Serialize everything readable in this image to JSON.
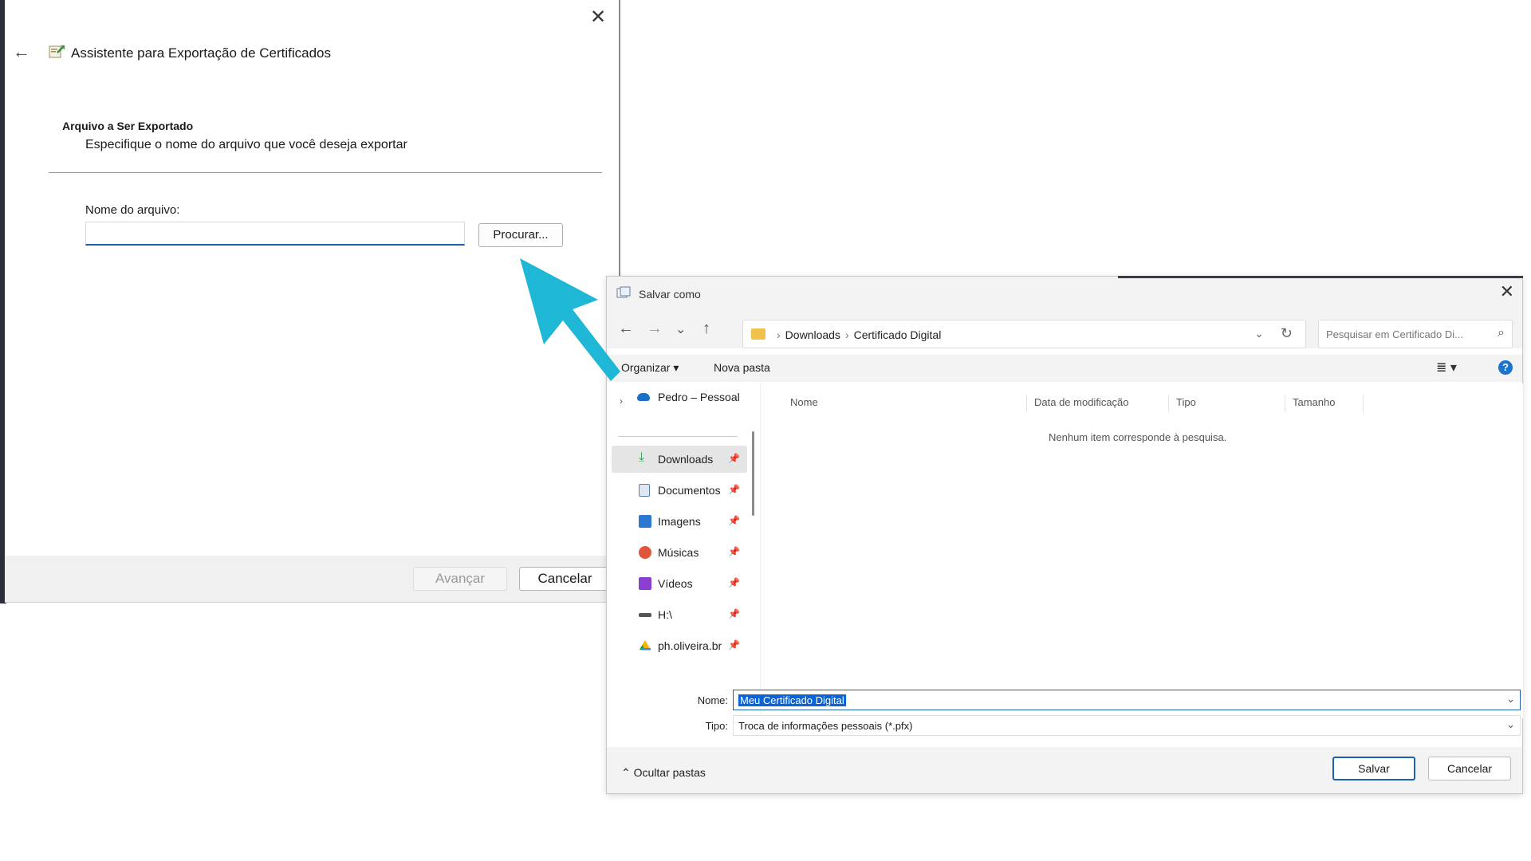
{
  "wizard": {
    "title": "Assistente para Exportação de Certificados",
    "heading": "Arquivo a Ser Exportado",
    "subheading": "Especifique o nome do arquivo que você deseja exportar",
    "file_label": "Nome do arquivo:",
    "file_value": "",
    "browse_label": "Procurar...",
    "next_label": "Avançar",
    "cancel_label": "Cancelar",
    "close_glyph": "✕",
    "back_glyph": "←"
  },
  "save_dialog": {
    "title": "Salvar como",
    "close_glyph": "✕",
    "nav": {
      "back": "←",
      "forward": "→",
      "recent": "⌄",
      "up": "↑"
    },
    "breadcrumb": [
      "Downloads",
      "Certificado Digital"
    ],
    "search_placeholder": "Pesquisar em Certificado Di...",
    "toolbar": {
      "organize": "Organizar ▾",
      "new_folder": "Nova pasta",
      "view": "≣ ▾",
      "help": "?"
    },
    "nav_pane": {
      "cloud": "Pedro – Pessoal",
      "items": [
        {
          "label": "Downloads",
          "icon": "download-icon",
          "color": "#2e9e4f"
        },
        {
          "label": "Documentos",
          "icon": "document-icon",
          "color": "#5a7fb5"
        },
        {
          "label": "Imagens",
          "icon": "image-icon",
          "color": "#2a78d0"
        },
        {
          "label": "Músicas",
          "icon": "music-icon",
          "color": "#e0563b"
        },
        {
          "label": "Vídeos",
          "icon": "video-icon",
          "color": "#8a3fd0"
        },
        {
          "label": "H:\\",
          "icon": "drive-icon",
          "color": "#555555"
        },
        {
          "label": "ph.oliveira.br",
          "icon": "google-drive-icon",
          "color": "#f4b400"
        }
      ]
    },
    "columns": [
      "Nome",
      "Data de modificação",
      "Tipo",
      "Tamanho"
    ],
    "empty_message": "Nenhum item corresponde à pesquisa.",
    "name_label": "Nome:",
    "name_value": "Meu Certificado Digital",
    "type_label": "Tipo:",
    "type_value": "Troca de informações pessoais (*.pfx)",
    "hide_folders": "Ocultar pastas",
    "save_label": "Salvar",
    "cancel_label": "Cancelar"
  },
  "colors": {
    "arrow": "#1fb7d6",
    "accent": "#1f5fb0"
  }
}
